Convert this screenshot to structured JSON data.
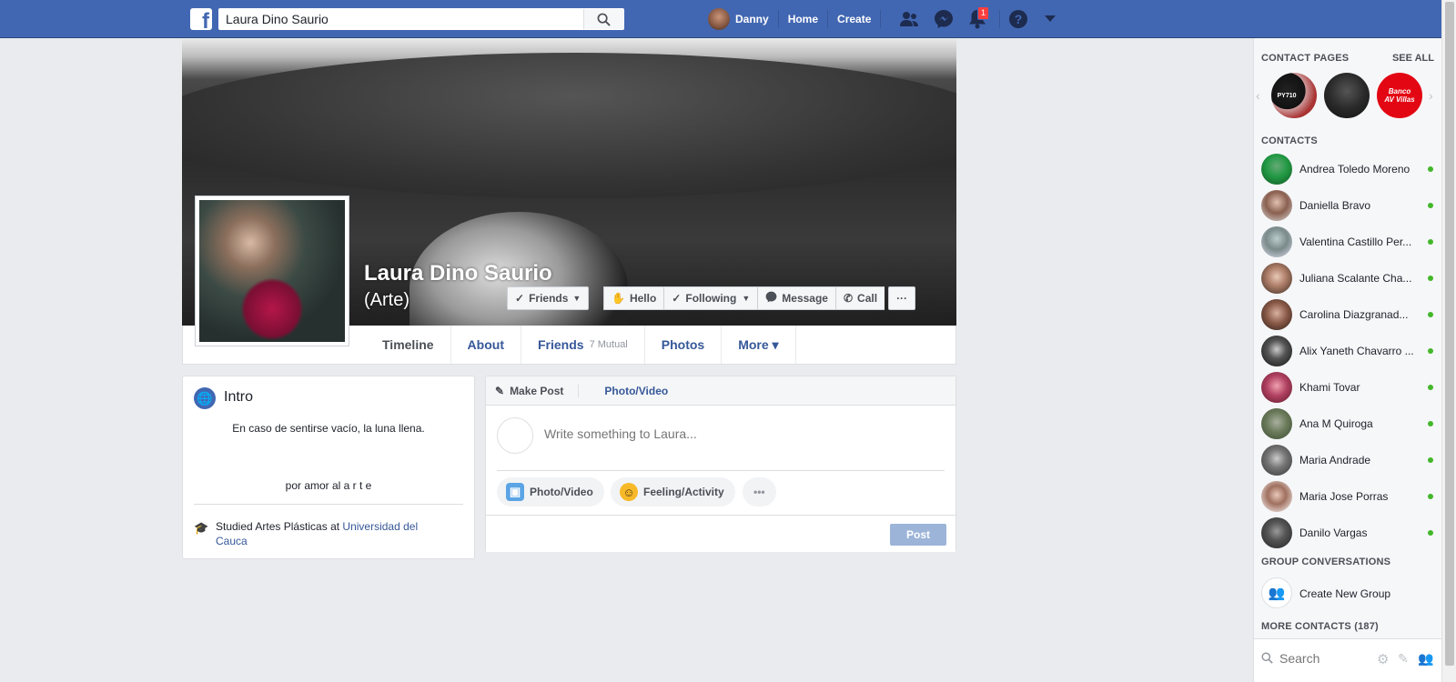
{
  "topbar": {
    "logo": "f",
    "search_value": "Laura Dino Saurio",
    "user_name": "Danny",
    "home": "Home",
    "create": "Create",
    "notification_count": "1",
    "brand_color": "#4267b2"
  },
  "profile": {
    "name": "Laura Dino Saurio",
    "subtitle": "(Arte)",
    "buttons": {
      "friends": "Friends",
      "hello": "Hello",
      "following": "Following",
      "message": "Message",
      "call": "Call",
      "more": "···"
    }
  },
  "timeline_nav": {
    "timeline": "Timeline",
    "about": "About",
    "friends": "Friends",
    "mutual": "7 Mutual",
    "photos": "Photos",
    "more": "More ▾"
  },
  "intro": {
    "title": "Intro",
    "bio_line1": "En caso de sentirse vacío, la luna llena.",
    "bio_line2": "por amor al a r t e",
    "edu_prefix": "Studied Artes Plásticas at ",
    "edu_link": "Universidad del Cauca"
  },
  "composer": {
    "make_post": "Make Post",
    "photo_video_tab": "Photo/Video",
    "placeholder": "Write something to Laura...",
    "photo_video": "Photo/Video",
    "feeling": "Feeling/Activity",
    "more": "•••",
    "post": "Post"
  },
  "sidebar": {
    "contact_pages": "CONTACT PAGES",
    "see_all": "SEE ALL",
    "pages": [
      {
        "label": "PY710"
      },
      {
        "label": ""
      },
      {
        "label": "Banco AV Villas"
      }
    ],
    "contacts_header": "CONTACTS",
    "contacts": [
      {
        "name": "Andrea Toledo Moreno"
      },
      {
        "name": "Daniella Bravo"
      },
      {
        "name": "Valentina Castillo Per..."
      },
      {
        "name": "Juliana Scalante Cha..."
      },
      {
        "name": "Carolina Diazgranad..."
      },
      {
        "name": "Alix Yaneth Chavarro ..."
      },
      {
        "name": "Khami Tovar"
      },
      {
        "name": "Ana M Quiroga"
      },
      {
        "name": "Maria Andrade"
      },
      {
        "name": "Maria Jose Porras"
      },
      {
        "name": "Danilo Vargas"
      }
    ],
    "group_conversations": "GROUP CONVERSATIONS",
    "create_new_group": "Create New Group",
    "more_contacts": "MORE CONTACTS (187)",
    "search_placeholder": "Search",
    "online_color": "#42b72a"
  }
}
